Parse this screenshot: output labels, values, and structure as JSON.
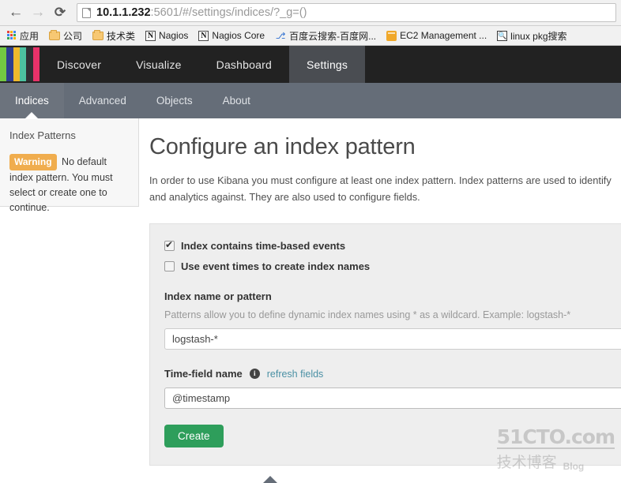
{
  "browser": {
    "back_icon": "back-arrow-icon",
    "forward_icon": "forward-arrow-icon",
    "reload_icon": "reload-icon",
    "reload_glyph": "⟳",
    "back_glyph": "←",
    "forward_glyph": "→",
    "url": {
      "host": "10.1.1.232",
      "path": ":5601/#/settings/indices/?_g=()",
      "full": "10.1.1.232:5601/#/settings/indices/?_g=()"
    },
    "bookmarks": [
      {
        "label": "应用",
        "icon": "apps-grid-icon"
      },
      {
        "label": "公司",
        "icon": "folder-icon"
      },
      {
        "label": "技术类",
        "icon": "folder-icon"
      },
      {
        "label": "Nagios",
        "icon": "nagios-n-icon"
      },
      {
        "label": "Nagios Core",
        "icon": "nagios-n-icon"
      },
      {
        "label": "百度云搜索-百度网...",
        "icon": "baidu-paw-icon"
      },
      {
        "label": "EC2 Management ...",
        "icon": "ec2-cube-icon"
      },
      {
        "label": "linux pkg搜索",
        "icon": "magnifier-icon"
      }
    ]
  },
  "kibana": {
    "logo_colors": [
      "#73c843",
      "#2e3e8f",
      "#f0b92c",
      "#4cc2a0",
      "#2f3033",
      "#e8326a"
    ],
    "topnav": [
      {
        "label": "Discover",
        "active": false
      },
      {
        "label": "Visualize",
        "active": false
      },
      {
        "label": "Dashboard",
        "active": false
      },
      {
        "label": "Settings",
        "active": true
      }
    ],
    "subnav": [
      {
        "label": "Indices",
        "active": true
      },
      {
        "label": "Advanced",
        "active": false
      },
      {
        "label": "Objects",
        "active": false
      },
      {
        "label": "About",
        "active": false
      }
    ],
    "sidebar": {
      "title": "Index Patterns",
      "warning_badge": "Warning",
      "warning_text": " No default index pattern. You must select or create one to continue."
    },
    "main": {
      "heading": "Configure an index pattern",
      "intro": "In order to use Kibana you must configure at least one index pattern. Index patterns are used to identify and analytics against. They are also used to configure fields.",
      "checkbox_time_based": {
        "label": "Index contains time-based events",
        "checked": true
      },
      "checkbox_event_times": {
        "label": "Use event times to create index names",
        "checked": false
      },
      "index_pattern": {
        "label": "Index name or pattern",
        "help": "Patterns allow you to define dynamic index names using * as a wildcard. Example: logstash-*",
        "value": "logstash-*",
        "placeholder": "logstash-*"
      },
      "time_field": {
        "label": "Time-field name",
        "info_icon": "info-circle-icon",
        "info_glyph": "i",
        "refresh_link": "refresh fields",
        "value": "@timestamp"
      },
      "create_button": "Create"
    },
    "accent": {
      "warning": "#f0ad4e",
      "create_green": "#2e9e5b",
      "link": "#4a90a4",
      "topnav_bg": "#222222",
      "subnav_bg": "#656d78"
    }
  },
  "watermark": {
    "line1": "51CTO.com",
    "line2": "技术博客",
    "line3": "Blog"
  }
}
